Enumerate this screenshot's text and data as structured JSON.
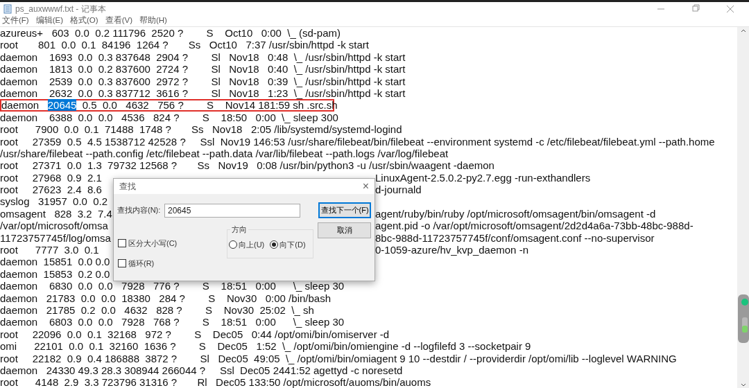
{
  "window": {
    "title": "ps_auxwwwf.txt - 记事本"
  },
  "menu": [
    {
      "label": "文件(F)"
    },
    {
      "label": "编辑(E)"
    },
    {
      "label": "格式(O)"
    },
    {
      "label": "查看(V)"
    },
    {
      "label": "帮助(H)"
    }
  ],
  "lines": [
    {
      "kind": "plain",
      "text": "azureus+   603  0.0  0.2 111796  2520 ?        S    Oct10   0:00  \\_ (sd-pam)"
    },
    {
      "kind": "plain",
      "text": "root       801  0.0  0.1  84196  1264 ?       Ss   Oct10   7:37 /usr/sbin/httpd -k start"
    },
    {
      "kind": "plain",
      "text": "daemon    1693  0.0  0.3 837648  2904 ?        Sl   Nov18   0:48  \\_ /usr/sbin/httpd -k start"
    },
    {
      "kind": "plain",
      "text": "daemon    1813  0.0  0.2 837600  2724 ?        Sl   Nov18   0:40  \\_ /usr/sbin/httpd -k start"
    },
    {
      "kind": "plain",
      "text": "daemon    2539  0.0  0.3 837600  2972 ?        Sl   Nov18   0:39  \\_ /usr/sbin/httpd -k start"
    },
    {
      "kind": "plain",
      "text": "daemon    2632  0.0  0.3 837712  3616 ?        Sl   Nov18   1:23  \\_ /usr/sbin/httpd -k start"
    },
    {
      "kind": "match",
      "before": "daemon   ",
      "match": "20645",
      "after": "  0.5  0.0   4632   756 ?        S    Nov14 181:59 sh .src.sh",
      "outlined": true
    },
    {
      "kind": "plain",
      "text": "daemon    6388  0.0  0.0   4536   824 ?        S    18:50   0:00  \\_ sleep 300"
    },
    {
      "kind": "plain",
      "text": "root      7900  0.0  0.1  71488  1748 ?       Ss   Nov18   2:05 /lib/systemd/systemd-logind"
    },
    {
      "kind": "plain",
      "text": "root     27359  0.5  4.5 1538712 42528 ?     Ssl  Nov19 146:53 /usr/share/filebeat/bin/filebeat --environment systemd -c /etc/filebeat/filebeat.yml --path.home"
    },
    {
      "kind": "plain",
      "text": "/usr/share/filebeat --path.config /etc/filebeat --path.data /var/lib/filebeat --path.logs /var/log/filebeat"
    },
    {
      "kind": "plain",
      "text": "root     27371  0.0  1.3  79732 12568 ?       Ss   Nov19   0:08 /usr/bin/python3 -u /usr/sbin/waagent -daemon"
    },
    {
      "kind": "split",
      "text": "root     27968  0.9  2.1",
      "continuation": "LinuxAgent-2.5.0.2-py2.7.egg -run-exthandlers"
    },
    {
      "kind": "split",
      "text": "root     27623  2.4  8.6",
      "continuation": "d-journald"
    },
    {
      "kind": "plain",
      "text": "syslog   31957  0.0  0.2"
    },
    {
      "kind": "split",
      "text": "omsagent   828  3.2  7.4",
      "continuation": "agent/ruby/bin/ruby /opt/microsoft/omsagent/bin/omsagent -d"
    },
    {
      "kind": "split",
      "text": "/var/opt/microsoft/omsa",
      "continuation": "agent.pid -o /var/opt/microsoft/omsagent/2d2d4a6a-73bb-48bc-988d-"
    },
    {
      "kind": "split",
      "text": "11723757745f/log/omsa",
      "continuation": "8bc-988d-11723757745f/conf/omsagent.conf --no-supervisor"
    },
    {
      "kind": "split",
      "text": "root      7777  3.0  0.1",
      "continuation": "0-1059-azure/hv_kvp_daemon -n"
    },
    {
      "kind": "plain",
      "text": "daemon  15851  0.0 0.0"
    },
    {
      "kind": "plain",
      "text": "daemon  15853  0.2 0.0"
    },
    {
      "kind": "plain",
      "text": "daemon    6830  0.0  0.0   7928   776 ?        S    18:51   0:00      \\_ sleep 30"
    },
    {
      "kind": "plain",
      "text": "daemon   21783  0.0  0.0  18380   284 ?        S    Nov30   0:00 /bin/bash"
    },
    {
      "kind": "plain",
      "text": "daemon   21785  0.2  0.0   4632   828 ?        S    Nov30  25:02  \\_ sh"
    },
    {
      "kind": "plain",
      "text": "daemon    6803  0.0  0.0   7928   768 ?        S    18:51   0:00      \\_ sleep 30"
    },
    {
      "kind": "plain",
      "text": "root     22096  0.0  0.1  32168   972 ?        S    Dec05   0:44 /opt/omi/bin/omiserver -d"
    },
    {
      "kind": "plain",
      "text": "omi      22101  0.0  0.1  32160  1636 ?        S    Dec05   1:52  \\_ /opt/omi/bin/omiengine -d --logfilefd 3 --socketpair 9"
    },
    {
      "kind": "plain",
      "text": "root     22182  0.9  0.4 186888  3872 ?        Sl   Dec05  49:05  \\_ /opt/omi/bin/omiagent 9 10 --destdir / --providerdir /opt/omi/lib --loglevel WARNING"
    },
    {
      "kind": "plain",
      "text": "daemon   24330 49.3 28.3 308944 266044 ?     Ssl  Dec05 2441:52 agettyd -c noresetd"
    },
    {
      "kind": "plain",
      "text": "root      4148  2.9  3.3 723796 31316 ?       Rl   Dec05 133:50 /opt/microsoft/auoms/bin/auoms"
    }
  ],
  "find_dialog": {
    "title": "查找",
    "close": "×",
    "find_label": "查找内容(N):",
    "find_value": "20645",
    "buttons": [
      {
        "label": "查找下一个(F)",
        "default": true
      },
      {
        "label": "取消",
        "default": false
      }
    ],
    "direction": {
      "label": "方向",
      "options": [
        {
          "label": "向上(U)",
          "selected": false
        },
        {
          "label": "向下(D)",
          "selected": true
        }
      ]
    },
    "checkboxes": [
      {
        "label": "区分大小写(C)",
        "checked": false
      },
      {
        "label": "循环(R)",
        "checked": false
      }
    ]
  }
}
